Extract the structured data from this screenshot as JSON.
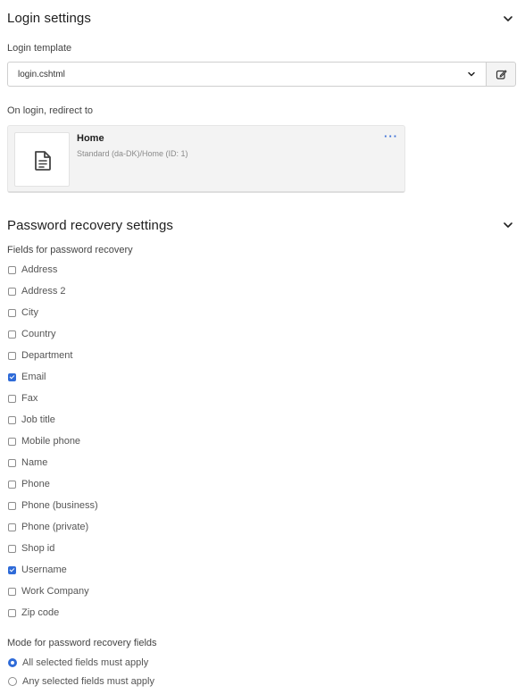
{
  "login_settings": {
    "title": "Login settings",
    "template_label": "Login template",
    "template_value": "login.cshtml",
    "redirect_label": "On login, redirect to",
    "redirect_page": {
      "name": "Home",
      "path": "Standard (da-DK)/Home (ID: 1)",
      "menu_label": "···"
    }
  },
  "password_recovery": {
    "title": "Password recovery settings",
    "fields_label": "Fields for password recovery",
    "fields": [
      {
        "label": "Address",
        "checked": false
      },
      {
        "label": "Address 2",
        "checked": false
      },
      {
        "label": "City",
        "checked": false
      },
      {
        "label": "Country",
        "checked": false
      },
      {
        "label": "Department",
        "checked": false
      },
      {
        "label": "Email",
        "checked": true
      },
      {
        "label": "Fax",
        "checked": false
      },
      {
        "label": "Job title",
        "checked": false
      },
      {
        "label": "Mobile phone",
        "checked": false
      },
      {
        "label": "Name",
        "checked": false
      },
      {
        "label": "Phone",
        "checked": false
      },
      {
        "label": "Phone (business)",
        "checked": false
      },
      {
        "label": "Phone (private)",
        "checked": false
      },
      {
        "label": "Shop id",
        "checked": false
      },
      {
        "label": "Username",
        "checked": true
      },
      {
        "label": "Work Company",
        "checked": false
      },
      {
        "label": "Zip code",
        "checked": false
      }
    ],
    "mode_label": "Mode for password recovery fields",
    "modes": [
      {
        "label": "All selected fields must apply",
        "selected": true
      },
      {
        "label": "Any selected fields must apply",
        "selected": false
      }
    ]
  },
  "colors": {
    "accent": "#2f6bd8",
    "card_bg": "#f3f3f3"
  },
  "icons": {
    "collapse": "chevron-down-icon",
    "select_caret": "caret-down-icon",
    "edit": "edit-icon",
    "page": "document-icon",
    "menu": "more-horizontal-icon"
  }
}
